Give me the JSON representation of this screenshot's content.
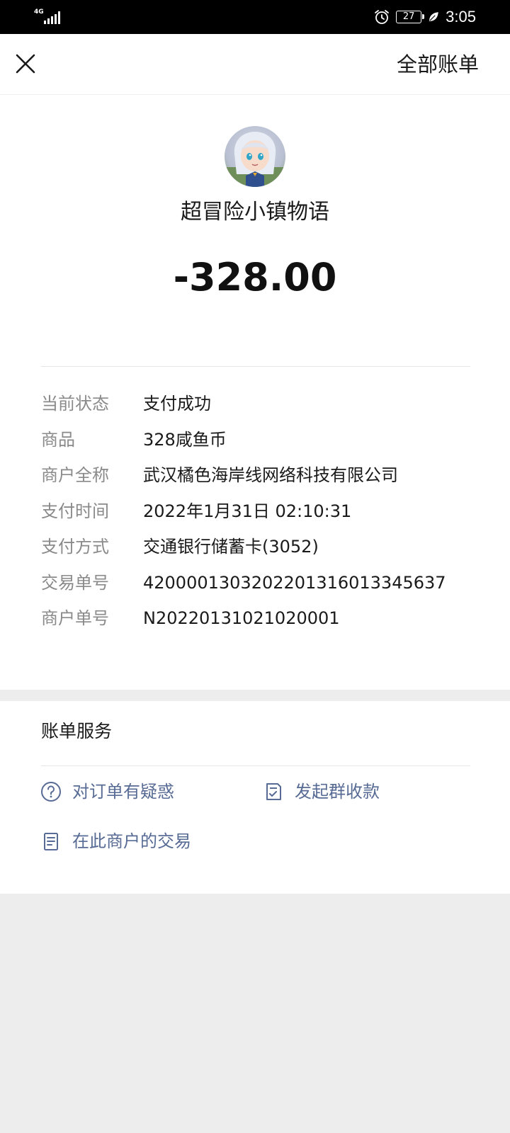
{
  "status_bar": {
    "network": "4G",
    "battery": "27",
    "time": "3:05"
  },
  "header": {
    "all_bills_label": "全部账单"
  },
  "bill": {
    "merchant_name": "超冒险小镇物语",
    "amount": "-328.00"
  },
  "details": [
    {
      "label": "当前状态",
      "value": "支付成功"
    },
    {
      "label": "商品",
      "value": "328咸鱼币"
    },
    {
      "label": "商户全称",
      "value": "武汉橘色海岸线网络科技有限公司"
    },
    {
      "label": "支付时间",
      "value": "2022年1月31日 02:10:31"
    },
    {
      "label": "支付方式",
      "value": "交通银行储蓄卡(3052)"
    },
    {
      "label": "交易单号",
      "value": "4200001303202201316013345637"
    },
    {
      "label": "商户单号",
      "value": "N20220131021020001"
    }
  ],
  "services": {
    "title": "账单服务",
    "items": [
      {
        "label": "对订单有疑惑",
        "icon": "question-icon"
      },
      {
        "label": "发起群收款",
        "icon": "receipt-check-icon"
      },
      {
        "label": "在此商户的交易",
        "icon": "document-icon"
      }
    ]
  },
  "colors": {
    "link": "#576b95",
    "label_gray": "#8a8a8a",
    "page_bg": "#ededed"
  }
}
